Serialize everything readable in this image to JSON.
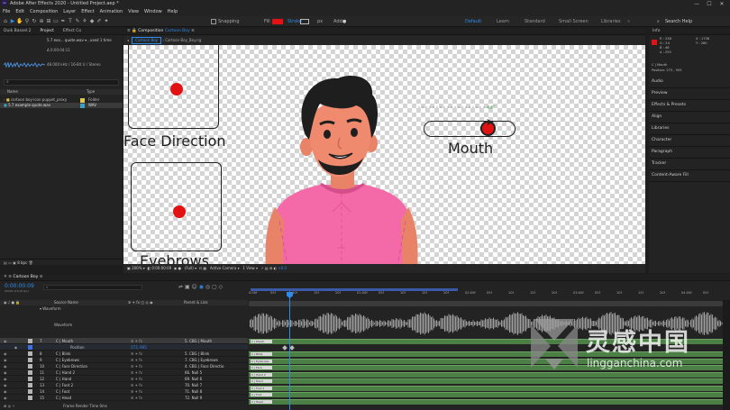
{
  "app": {
    "title": "Adobe After Effects 2020 - Untitled Project.aep *",
    "logo": "Ae"
  },
  "window_controls": [
    "—",
    "☐",
    "✕"
  ],
  "menu": [
    "File",
    "Edit",
    "Composition",
    "Layer",
    "Effect",
    "Animation",
    "View",
    "Window",
    "Help"
  ],
  "toolbar": {
    "snapping": "Snapping",
    "fill": "Fill",
    "stroke": "Stroke",
    "stroke_px": "px",
    "add": "Add:"
  },
  "workspaces": [
    "Default",
    "Learn",
    "Standard",
    "Small Screen",
    "Libraries"
  ],
  "search_help": "Search Help",
  "project": {
    "tabs": [
      "Duik Bassel.2",
      "Project",
      "Effect Co"
    ],
    "asset_name": "5.7 exa... quote.wav ▾ , used 1 time",
    "asset_duration": "Δ 0:00:04:11",
    "asset_info": "48.000 kHz / 16-Bit U / Stereo",
    "search_placeholder": "⌕",
    "columns": [
      "Name",
      "Type"
    ],
    "items": [
      {
        "name": "cartoon boy-icon puppet_proxy",
        "type": "Folder",
        "color": "#e0c84a"
      },
      {
        "name": "5.7 example quote.wav",
        "type": "WAV",
        "color": "#3aa1c7"
      }
    ],
    "bpc": "8 bpc"
  },
  "composition": {
    "panel_title": "Composition",
    "comp_name": "Cartoon Boy",
    "tabs": [
      "Cartoon Boy",
      "Cartoon Boy_Boy.ng"
    ],
    "labels": [
      "Face Direction",
      "Eyebrows",
      "Mouth"
    ],
    "footer": {
      "zoom": "200%",
      "time": "0:00:00:09",
      "resolution": "(Full)",
      "camera": "Active Camera",
      "views": "1 View",
      "offset": "+0.0"
    }
  },
  "right_panels": {
    "info_title": "Info",
    "info_rgb": [
      "R : 238",
      "G : 24",
      "B : 46",
      "A : 255"
    ],
    "info_xy": [
      "X : 1736",
      "Y : 280"
    ],
    "info_layer": "C | Mouth",
    "info_pos": "Position: 273 , 905",
    "items": [
      "Audio",
      "Preview",
      "Effects & Presets",
      "Align",
      "Libraries",
      "Character",
      "Paragraph",
      "Tracker",
      "Content-Aware Fill"
    ],
    "accent": "#e31212"
  },
  "timeline": {
    "comp_tab": "Cartoon Boy",
    "timecode": "0:00:00:09",
    "fps": "00009 (25.00 fps)",
    "columns": [
      "Source Name",
      "Parent & Link"
    ],
    "waveform_group": "Waveform",
    "waveform": "Waveform",
    "ruler": [
      "0:00f",
      "05f",
      "10f",
      "15f",
      "20f",
      "01:00f",
      "05f",
      "10f",
      "15f",
      "20f",
      "02:00f",
      "05f",
      "10f",
      "15f",
      "20f",
      "03:00f",
      "05f",
      "10f",
      "15f",
      "20f",
      "04:00f",
      "05f"
    ],
    "layers": [
      {
        "num": "7",
        "name": "C | Mouth",
        "parent": "5. CBG | Mouth",
        "bar": "C | Mouth",
        "selected": true,
        "color": "#b5b5b5"
      },
      {
        "num": "",
        "name": "Position",
        "parent": "273, 905",
        "bar": "",
        "property": true,
        "color": "#3a6fe6"
      },
      {
        "num": "8",
        "name": "C | Blink",
        "parent": "5. CBG | Blink",
        "bar": "C | Blink",
        "color": "#b5b5b5"
      },
      {
        "num": "9",
        "name": "C | Eyebrows",
        "parent": "7. CBG | Eyebrows",
        "bar": "C | Eyebrows",
        "color": "#b5b5b5"
      },
      {
        "num": "10",
        "name": "C | Face Direction",
        "parent": "4. CBG | Face Directio",
        "bar": "C | Face Direction",
        "color": "#b5b5b5"
      },
      {
        "num": "11",
        "name": "C | Hand 2",
        "parent": "66. Null 5",
        "bar": "C | Hand 2",
        "color": "#b5b5b5"
      },
      {
        "num": "12",
        "name": "C | Hand",
        "parent": "69. Null 6",
        "bar": "C | Hand",
        "color": "#b5b5b5"
      },
      {
        "num": "13",
        "name": "C | Foot 2",
        "parent": "70. Null 7",
        "bar": "C | Foot 2",
        "color": "#b5b5b5"
      },
      {
        "num": "14",
        "name": "C | Foot",
        "parent": "71. Null 8",
        "bar": "C | Foot",
        "color": "#b5b5b5"
      },
      {
        "num": "15",
        "name": "C | Head",
        "parent": "72. Null 9",
        "bar": "C | Head",
        "color": "#b5b5b5"
      }
    ],
    "footer": "Toggle Switches / Modes",
    "frame_render": "Frame Render Time 0ms"
  },
  "watermark": {
    "cn": "灵感中国",
    "url": "lingganchina.com"
  }
}
